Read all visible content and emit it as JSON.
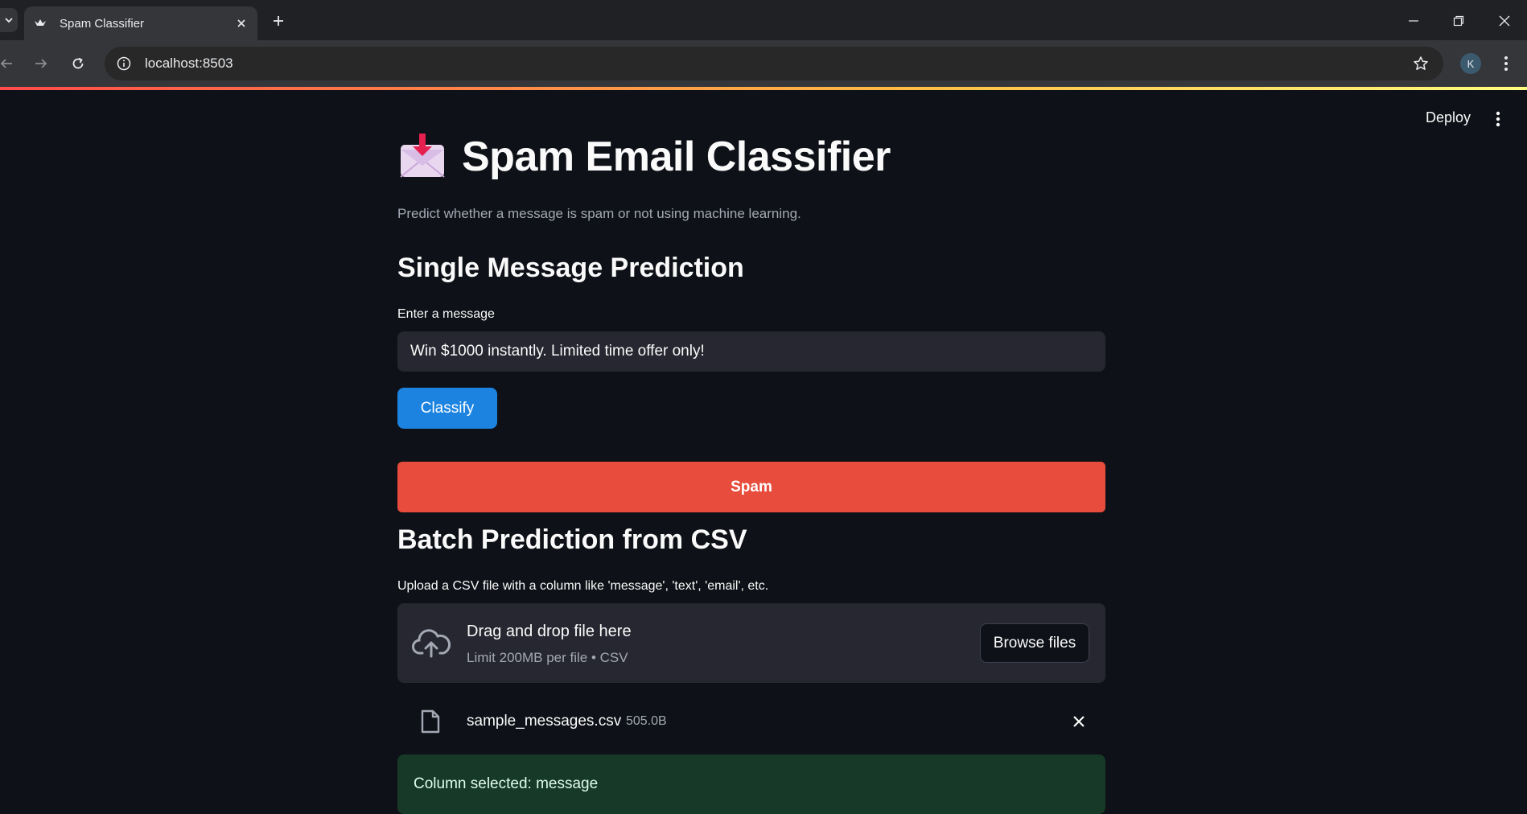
{
  "browser": {
    "tab_title": "Spam Classifier",
    "url": "localhost:8503",
    "profile_initial": "K"
  },
  "header": {
    "deploy_label": "Deploy"
  },
  "page": {
    "title": "Spam Email Classifier",
    "title_icon": "incoming-envelope-icon",
    "subtitle": "Predict whether a message is spam or not using machine learning."
  },
  "single": {
    "heading": "Single Message Prediction",
    "input_label": "Enter a message",
    "input_value": "Win $1000 instantly. Limited time offer only!",
    "button_label": "Classify",
    "result": "Spam",
    "result_color": "#e74c3c"
  },
  "batch": {
    "heading": "Batch Prediction from CSV",
    "upload_label": "Upload a CSV file with a column like 'message', 'text', 'email', etc.",
    "dropzone_title": "Drag and drop file here",
    "dropzone_hint": "Limit 200MB per file • CSV",
    "browse_label": "Browse files",
    "file_name": "sample_messages.csv",
    "file_size": "505.0B",
    "success_message": "Column selected: message"
  },
  "colors": {
    "accent": "#1c83e1",
    "spam": "#e74c3c",
    "success_bg": "#173928",
    "background": "#0e1117"
  }
}
